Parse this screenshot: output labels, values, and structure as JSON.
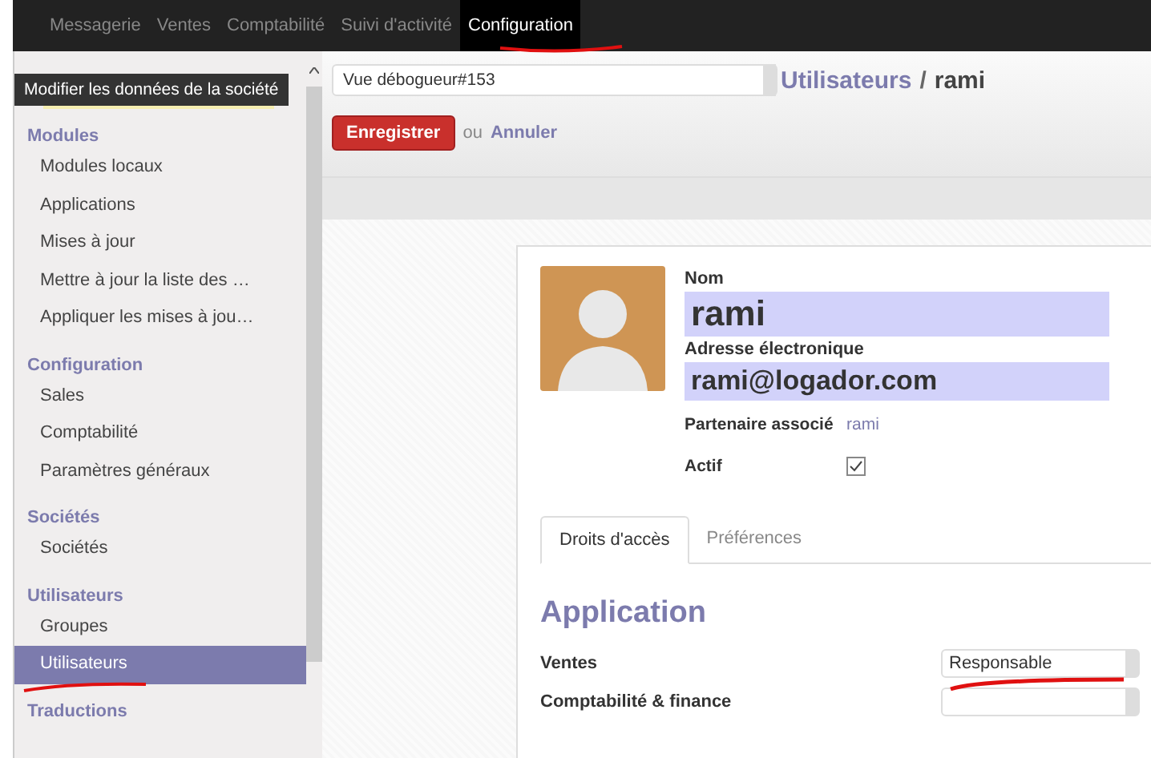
{
  "top_menu": [
    {
      "label": "Messagerie",
      "selected": false
    },
    {
      "label": "Ventes",
      "selected": false
    },
    {
      "label": "Comptabilité",
      "selected": false
    },
    {
      "label": "Suivi d'activité",
      "selected": false
    },
    {
      "label": "Configuration",
      "selected": true
    }
  ],
  "tooltip": "Modifier les données de la société",
  "sidebar": {
    "sections": [
      {
        "title": "Modules",
        "items": [
          {
            "label": "Modules locaux",
            "selected": false
          },
          {
            "label": "Applications",
            "selected": false
          },
          {
            "label": "Mises à jour",
            "selected": false
          },
          {
            "label": "Mettre à jour la liste des …",
            "selected": false
          },
          {
            "label": "Appliquer les mises à jou…",
            "selected": false
          }
        ]
      },
      {
        "title": "Configuration",
        "items": [
          {
            "label": "Sales",
            "selected": false
          },
          {
            "label": "Comptabilité",
            "selected": false
          },
          {
            "label": "Paramètres généraux",
            "selected": false
          }
        ]
      },
      {
        "title": "Sociétés",
        "items": [
          {
            "label": "Sociétés",
            "selected": false
          }
        ]
      },
      {
        "title": "Utilisateurs",
        "items": [
          {
            "label": "Groupes",
            "selected": false
          },
          {
            "label": "Utilisateurs",
            "selected": true
          }
        ]
      },
      {
        "title": "Traductions"
      }
    ]
  },
  "debug_select": "Vue débogueur#153",
  "breadcrumb": {
    "parent": "Utilisateurs",
    "separator": "/",
    "current": "rami"
  },
  "save_button": "Enregistrer",
  "or_text": "ou",
  "cancel_link": "Annuler",
  "form": {
    "name_label": "Nom",
    "name": "rami",
    "email_label": "Adresse électronique",
    "email": "rami@logador.com",
    "partner_label": "Partenaire associé",
    "partner": "rami",
    "active_label": "Actif",
    "active": true,
    "tabs": [
      {
        "label": "Droits d'accès",
        "selected": true
      },
      {
        "label": "Préférences",
        "selected": false
      }
    ],
    "section_title": "Application",
    "fields": [
      {
        "label": "Ventes",
        "value": "Responsable"
      },
      {
        "label": "Comptabilité & finance"
      }
    ]
  }
}
